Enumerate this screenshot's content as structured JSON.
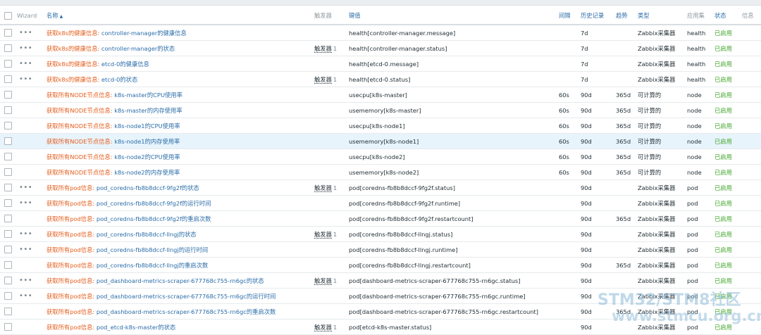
{
  "headers": {
    "wizard": "Wizard",
    "name": "名称",
    "sort_indicator": "▲",
    "triggers": "触发器",
    "key": "键值",
    "interval": "间隔",
    "history": "历史记录",
    "trends": "趋势",
    "type": "类型",
    "app": "应用集",
    "status": "状态",
    "info": "信息"
  },
  "rows": [
    {
      "dots": "•••",
      "prefix": "获取k8s的健康信息:",
      "name": "controller-manager的健康信息",
      "trigger": "",
      "trigger_count": "",
      "key": "health[controller-manager.message]",
      "interval": "",
      "history": "7d",
      "trends": "",
      "type": "Zabbix采集器",
      "app": "health",
      "status": "已启用"
    },
    {
      "dots": "•••",
      "prefix": "获取k8s的健康信息:",
      "name": "controller-manager的状态",
      "trigger": "触发器",
      "trigger_count": "1",
      "key": "health[controller-manager.status]",
      "interval": "",
      "history": "7d",
      "trends": "",
      "type": "Zabbix采集器",
      "app": "health",
      "status": "已启用"
    },
    {
      "dots": "•••",
      "prefix": "获取k8s的健康信息:",
      "name": "etcd-0的健康信息",
      "trigger": "",
      "trigger_count": "",
      "key": "health[etcd-0.message]",
      "interval": "",
      "history": "7d",
      "trends": "",
      "type": "Zabbix采集器",
      "app": "health",
      "status": "已启用"
    },
    {
      "dots": "•••",
      "prefix": "获取k8s的健康信息:",
      "name": "etcd-0的状态",
      "trigger": "触发器",
      "trigger_count": "1",
      "key": "health[etcd-0.status]",
      "interval": "",
      "history": "7d",
      "trends": "",
      "type": "Zabbix采集器",
      "app": "health",
      "status": "已启用"
    },
    {
      "dots": "",
      "prefix": "获取所有NODE节点信息:",
      "name": "k8s-master的CPU使用率",
      "trigger": "",
      "trigger_count": "",
      "key": "usecpu[k8s-master]",
      "interval": "60s",
      "history": "90d",
      "trends": "365d",
      "type": "可计算的",
      "app": "node",
      "status": "已启用"
    },
    {
      "dots": "",
      "prefix": "获取所有NODE节点信息:",
      "name": "k8s-master的内存使用率",
      "trigger": "",
      "trigger_count": "",
      "key": "usememory[k8s-master]",
      "interval": "60s",
      "history": "90d",
      "trends": "365d",
      "type": "可计算的",
      "app": "node",
      "status": "已启用"
    },
    {
      "dots": "",
      "prefix": "获取所有NODE节点信息:",
      "name": "k8s-node1的CPU使用率",
      "trigger": "",
      "trigger_count": "",
      "key": "usecpu[k8s-node1]",
      "interval": "60s",
      "history": "90d",
      "trends": "365d",
      "type": "可计算的",
      "app": "node",
      "status": "已启用"
    },
    {
      "dots": "",
      "prefix": "获取所有NODE节点信息:",
      "name": "k8s-node1的内存使用率",
      "trigger": "",
      "trigger_count": "",
      "key": "usememory[k8s-node1]",
      "interval": "60s",
      "history": "90d",
      "trends": "365d",
      "type": "可计算的",
      "app": "node",
      "status": "已启用",
      "highlight": true
    },
    {
      "dots": "",
      "prefix": "获取所有NODE节点信息:",
      "name": "k8s-node2的CPU使用率",
      "trigger": "",
      "trigger_count": "",
      "key": "usecpu[k8s-node2]",
      "interval": "60s",
      "history": "90d",
      "trends": "365d",
      "type": "可计算的",
      "app": "node",
      "status": "已启用"
    },
    {
      "dots": "",
      "prefix": "获取所有NODE节点信息:",
      "name": "k8s-node2的内存使用率",
      "trigger": "",
      "trigger_count": "",
      "key": "usememory[k8s-node2]",
      "interval": "60s",
      "history": "90d",
      "trends": "365d",
      "type": "可计算的",
      "app": "node",
      "status": "已启用"
    },
    {
      "dots": "•••",
      "prefix": "获取所有pod信息:",
      "name": "pod_coredns-fb8b8dccf-9fg2f的状态",
      "trigger": "触发器",
      "trigger_count": "1",
      "key": "pod[coredns-fb8b8dccf-9fg2f.status]",
      "interval": "",
      "history": "90d",
      "trends": "",
      "type": "Zabbix采集器",
      "app": "pod",
      "status": "已启用"
    },
    {
      "dots": "•••",
      "prefix": "获取所有pod信息:",
      "name": "pod_coredns-fb8b8dccf-9fg2f的运行时间",
      "trigger": "",
      "trigger_count": "",
      "key": "pod[coredns-fb8b8dccf-9fg2f.runtime]",
      "interval": "",
      "history": "90d",
      "trends": "",
      "type": "Zabbix采集器",
      "app": "pod",
      "status": "已启用"
    },
    {
      "dots": "",
      "prefix": "获取所有pod信息:",
      "name": "pod_coredns-fb8b8dccf-9fg2f的重启次数",
      "trigger": "",
      "trigger_count": "",
      "key": "pod[coredns-fb8b8dccf-9fg2f.restartcount]",
      "interval": "",
      "history": "90d",
      "trends": "365d",
      "type": "Zabbix采集器",
      "app": "pod",
      "status": "已启用"
    },
    {
      "dots": "•••",
      "prefix": "获取所有pod信息:",
      "name": "pod_coredns-fb8b8dccf-llngj的状态",
      "trigger": "触发器",
      "trigger_count": "1",
      "key": "pod[coredns-fb8b8dccf-llngj.status]",
      "interval": "",
      "history": "90d",
      "trends": "",
      "type": "Zabbix采集器",
      "app": "pod",
      "status": "已启用"
    },
    {
      "dots": "•••",
      "prefix": "获取所有pod信息:",
      "name": "pod_coredns-fb8b8dccf-llngj的运行时间",
      "trigger": "",
      "trigger_count": "",
      "key": "pod[coredns-fb8b8dccf-llngj.runtime]",
      "interval": "",
      "history": "90d",
      "trends": "",
      "type": "Zabbix采集器",
      "app": "pod",
      "status": "已启用"
    },
    {
      "dots": "",
      "prefix": "获取所有pod信息:",
      "name": "pod_coredns-fb8b8dccf-llngj的重启次数",
      "trigger": "",
      "trigger_count": "",
      "key": "pod[coredns-fb8b8dccf-llngj.restartcount]",
      "interval": "",
      "history": "90d",
      "trends": "365d",
      "type": "Zabbix采集器",
      "app": "pod",
      "status": "已启用"
    },
    {
      "dots": "•••",
      "prefix": "获取所有pod信息:",
      "name": "pod_dashboard-metrics-scraper-677768c755-rn6gc的状态",
      "trigger": "触发器",
      "trigger_count": "1",
      "key": "pod[dashboard-metrics-scraper-677768c755-rn6gc.status]",
      "interval": "",
      "history": "90d",
      "trends": "",
      "type": "Zabbix采集器",
      "app": "pod",
      "status": "已启用"
    },
    {
      "dots": "•••",
      "prefix": "获取所有pod信息:",
      "name": "pod_dashboard-metrics-scraper-677768c755-rn6gc的运行时间",
      "trigger": "",
      "trigger_count": "",
      "key": "pod[dashboard-metrics-scraper-677768c755-rn6gc.runtime]",
      "interval": "",
      "history": "90d",
      "trends": "",
      "type": "Zabbix采集器",
      "app": "pod",
      "status": "已启用"
    },
    {
      "dots": "",
      "prefix": "获取所有pod信息:",
      "name": "pod_dashboard-metrics-scraper-677768c755-rn6gc的重启次数",
      "trigger": "",
      "trigger_count": "",
      "key": "pod[dashboard-metrics-scraper-677768c755-rn6gc.restartcount]",
      "interval": "",
      "history": "90d",
      "trends": "365d",
      "type": "Zabbix采集器",
      "app": "pod",
      "status": "已启用"
    },
    {
      "dots": "",
      "prefix": "获取所有pod信息:",
      "name": "pod_etcd-k8s-master的状态",
      "trigger": "触发器",
      "trigger_count": "1",
      "key": "pod[etcd-k8s-master.status]",
      "interval": "",
      "history": "90d",
      "trends": "",
      "type": "Zabbix采集器",
      "app": "pod",
      "status": "已启用"
    }
  ],
  "watermark": {
    "line1": "STM32/STM8社区",
    "line2": "www.stmcu.org.cn"
  },
  "colors": {
    "link": "#2b6da8",
    "prefix": "#e45d1c",
    "enabled": "#3fa529",
    "row_highlight": "#e8f4fc"
  }
}
